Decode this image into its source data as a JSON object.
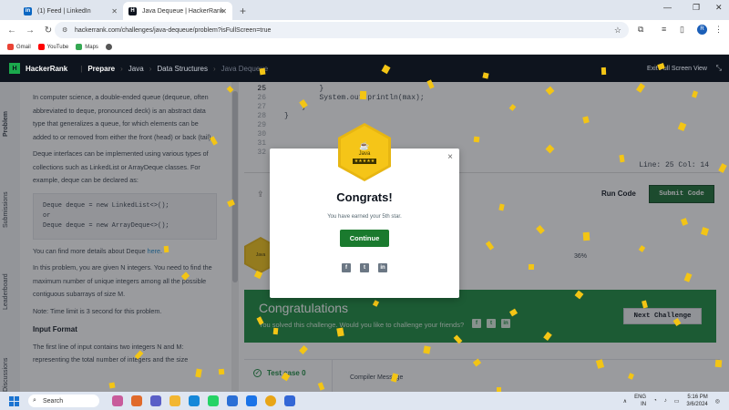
{
  "browser": {
    "tabs": [
      {
        "title": "(1) Feed | LinkedIn",
        "icon": "linkedin-icon"
      },
      {
        "title": "Java Dequeue | HackerRank",
        "icon": "hackerrank-icon"
      }
    ],
    "new_tab": "+",
    "url": "hackerrank.com/challenges/java-dequeue/problem?isFullScreen=true",
    "profile_initial": "R",
    "bookmarks": [
      "Gmail",
      "YouTube",
      "Maps"
    ]
  },
  "header": {
    "logo": "H",
    "brand": "HackerRank",
    "crumbs": [
      "Prepare",
      "Java",
      "Data Structures",
      "Java Dequeue"
    ],
    "exit_fullscreen": "Exit Full Screen View"
  },
  "sidetabs": [
    "Problem",
    "Submissions",
    "Leaderboard",
    "Discussions"
  ],
  "problem": {
    "p1": "In computer science, a double-ended queue (dequeue, often abbreviated to deque, pronounced deck) is an abstract data type that generalizes a queue, for which elements can be added to or removed from either the front (head) or back (tail).",
    "p2": "Deque interfaces can be implemented using various types of collections such as LinkedList or ArrayDeque classes. For example, deque can be declared as:",
    "code": [
      "Deque deque = new LinkedList<>();",
      "or",
      "Deque deque = new ArrayDeque<>();"
    ],
    "p3_pre": "You can find more details about Deque ",
    "p3_link": "here",
    "p4": "In this problem, you are given N integers. You need to find the maximum number of unique integers among all the possible contiguous subarrays of size M.",
    "p5": "Note: Time limit is 3 second for this problem.",
    "h_input": "Input Format",
    "p6": "The first line of input contains two integers N and M: representing the total number of integers and the size"
  },
  "editor": {
    "lines": [
      {
        "n": "25",
        "code": "        }"
      },
      {
        "n": "26",
        "code": "        System.out.println(max);"
      },
      {
        "n": "27",
        "code": "    }"
      },
      {
        "n": "28",
        "code": "}"
      },
      {
        "n": "29",
        "code": ""
      },
      {
        "n": "30",
        "code": ""
      },
      {
        "n": "31",
        "code": ""
      },
      {
        "n": "32",
        "code": ""
      }
    ],
    "status": "Line: 25 Col: 14",
    "run": "Run Code",
    "submit": "Submit Code"
  },
  "badge": {
    "label": "Java",
    "stars": "★★★★★",
    "progress": "36%"
  },
  "result": {
    "title": "Congratulations",
    "subtitle": "You solved this challenge. Would you like to challenge your friends?",
    "next": "Next Challenge",
    "test_case": "Test case 0",
    "compiler": "Compiler Message"
  },
  "modal": {
    "title": "Congrats!",
    "message": "You have earned your 5th star.",
    "button": "Continue",
    "close": "×",
    "social": [
      "facebook-icon",
      "twitter-icon",
      "linkedin-icon"
    ]
  },
  "taskbar": {
    "search": "Search",
    "lang": "ENG",
    "region": "IN",
    "time": "5:16 PM",
    "date": "3/6/2024"
  }
}
